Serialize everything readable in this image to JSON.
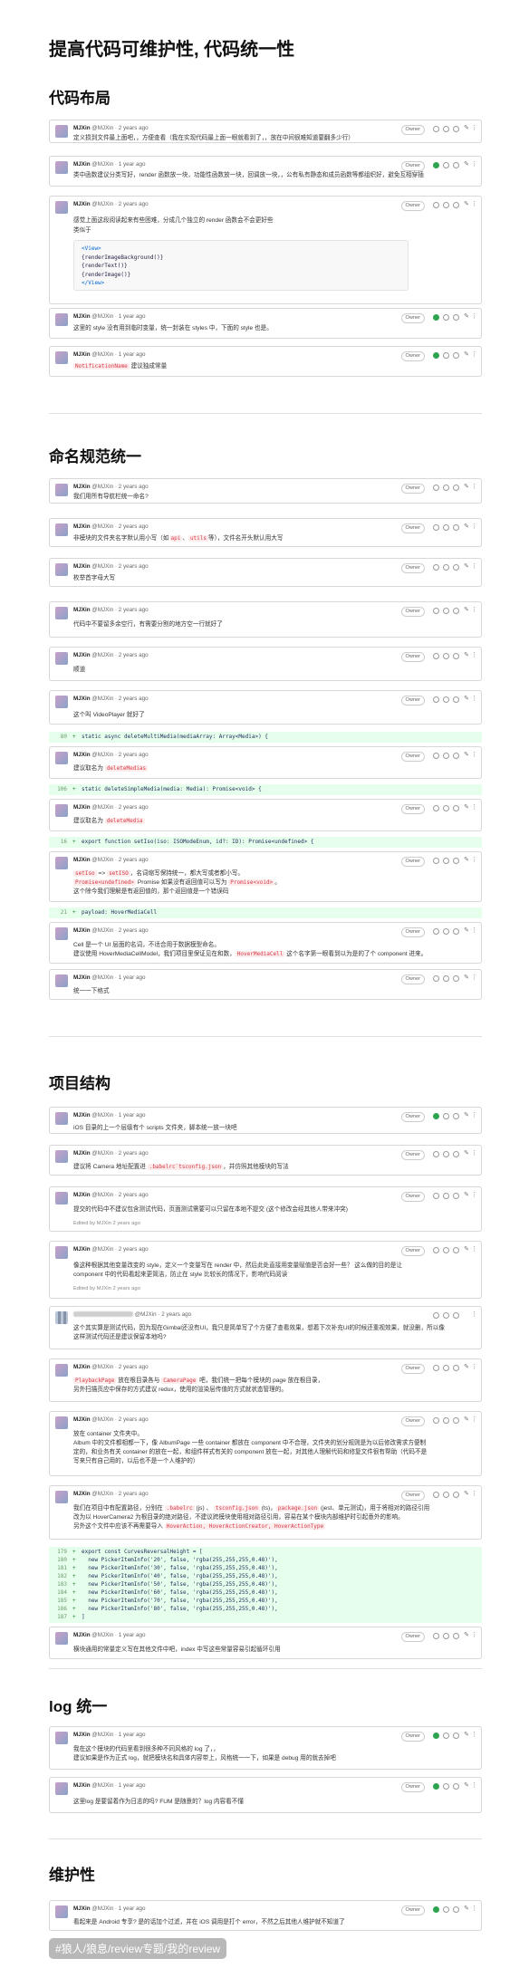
{
  "title": "提高代码可维护性, 代码统一性",
  "sections": {
    "s1": "代码布局",
    "s2": "命名规范统一",
    "s3": "项目结构",
    "s4": "log 统一",
    "s5": "维护性"
  },
  "common": {
    "owner": "Owner",
    "edit_icon": "pencil-icon",
    "more_icon": "more-icon"
  },
  "c": {
    "c1": {
      "name": "MJXin",
      "meta": "@MJXin · 2 years ago",
      "body": "定义损到文件最上面吧，，方便查看（我在实现代码最上面一眼就看到了，，放在中间很难知道要翻多少行）"
    },
    "c2": {
      "name": "MJXin",
      "meta": "@MJXin · 1 year ago",
      "body": "类中函数建议分类写好，render 函数放一块，功能性函数放一块，回调放一块，，公有私有静态和成员函数等都组织好，避免互相穿插"
    },
    "c3": {
      "name": "MJXin",
      "meta": "@MJXin · 2 years ago",
      "body1": "感觉上面这段阅读起来有些困难，分成几个独立的 render 函数会不会更好些",
      "body2": "类似于",
      "code": [
        "<View>",
        "  {renderImageBackground()}",
        "  {renderText()}",
        "  {renderImage()}",
        "</View>"
      ]
    },
    "c4": {
      "name": "MJXin",
      "meta": "@MJXin · 1 year ago",
      "body": "这里的 style 没有用到临时变量，统一封装在 styles 中，下面的 style 也是。"
    },
    "c5": {
      "name": "MJXin",
      "meta": "@MJXin · 1 year ago",
      "code": "NotificationName",
      "body": "建议独成常量"
    },
    "n1": {
      "name": "MJXin",
      "meta": "@MJXin · 2 years ago",
      "body": "我们用所有导航栏统一命名?"
    },
    "n2": {
      "name": "MJXin",
      "meta": "@MJXin · 2 years ago",
      "b1": "非模块的文件夹名字默认用小写（如",
      "k1": "api",
      "b2": "、",
      "k2": "utils",
      "b3": "等），文件名开头默认用大写"
    },
    "n3": {
      "name": "MJXin",
      "meta": "@MJXin · 2 years ago",
      "body": "枚举首字母大写"
    },
    "n4": {
      "name": "MJXin",
      "meta": "@MJXin · 2 years ago",
      "body": "代码中不要留多余空行，有需要分割的地方空一行就好了"
    },
    "n5": {
      "name": "MJXin",
      "meta": "@MJXin · 2 years ago",
      "body": "顺道"
    },
    "n6": {
      "name": "MJXin",
      "meta": "@MJXin · 2 years ago",
      "body": "这个叫 VideoPlayer 就好了"
    },
    "d1": {
      "ln": "80",
      "code": "static async deleteMultiMedia(mediaArray: Array<Media>) {"
    },
    "n7": {
      "name": "MJXin",
      "meta": "@MJXin · 2 years ago",
      "b1": "建议取名为",
      "k1": "deleteMedias"
    },
    "d2": {
      "ln": "106",
      "code": "static deleteSimpleMedia(media: Media): Promise<void> {"
    },
    "n8": {
      "name": "MJXin",
      "meta": "@MJXin · 2 years ago",
      "b1": "建议取名为",
      "k1": "deleteMedia"
    },
    "d3": {
      "ln": "16",
      "code": "export function setIso(iso: ISOModeEnum, id?: ID): Promise<undefined> {"
    },
    "n9": {
      "name": "MJXin",
      "meta": "@MJXin · 2 years ago",
      "k1": "setIso",
      "b1": " => ",
      "k2": "setISO",
      "b2": "，名词缩写保持统一，都大写或者都小写。",
      "k3": "Promise<undefined>",
      "b3": " Promise 如果没有返回值可以写为 ",
      "k4": "Promise<void>",
      "b4": "。",
      "b5": "这个除今我们理解是有返回值的，那个返回值是一个错误码"
    },
    "d4": {
      "ln": "21",
      "code": "payload: HoverMediaCell"
    },
    "n10": {
      "name": "MJXin",
      "meta": "@MJXin · 2 years ago",
      "b1": "Cell 是一个 UI 层面的名词，不适合用于数据模型命名。",
      "b2": "建议使用 HoverMediaCellModel，我们项目里保证见在和数，",
      "k1": "HoverMediaCell",
      "b3": " 这个名字第一眼看到以为是的了个 component 进来。"
    },
    "n11": {
      "name": "MJXin",
      "meta": "@MJXin · 1 year ago",
      "body": "统一一下格式"
    },
    "p1": {
      "name": "MJXin",
      "meta": "@MJXin · 1 year ago",
      "body": "iOS 目录的上一个层级有个 scripts 文件夹，脚本统一放一块吧"
    },
    "p2": {
      "name": "MJXin",
      "meta": "@MJXin · 2 years ago",
      "b1": "建议将 Camera 地址配置进 ",
      "k1": ".babelrc`tsconfig.json",
      "b2": "，并仿照其他模块的写法"
    },
    "p3": {
      "name": "MJXin",
      "meta": "@MJXin · 2 years ago",
      "body": "提交的代码中不建议包含测试代码，页面测试需要可以只留在本地不提交 (这个修改会经其他人带来冲突)",
      "edited": "Edited by MJXin 2 years ago"
    },
    "p4": {
      "name": "MJXin",
      "meta": "@MJXin · 2 years ago",
      "b1": "像这种根据其他变量改变的 style，定义一个变量写在 render 中，然后此处直接用变量赋值是否会好一些？ 这么做的目的是让",
      "b2": "component 中的代码看起来更简洁，防止在 style 比较长的情况下，影响代码阅读",
      "edited": "Edited by MJXin 2 years ago"
    },
    "p5": {
      "meta": "@MJXin · 2 years ago",
      "b1": "这个其实算是测试代码，因为现在Gimbal还没有UI，我只是简单写了个方便了查看效果，想着下次补充UI的时候还重视效果，就没删，所以像",
      "b2": "这样测试代码还是建议保留本地吗?"
    },
    "p6": {
      "name": "MJXin",
      "meta": "@MJXin · 2 years ago",
      "k1": "PlaybackPage",
      "b1": " 放在根目录各与 ",
      "k2": "CameraPage",
      "b2": " 吧，我们统一把每个模块的 page 放在根目录，",
      "b3": "另外扫描页应中保存的方式建议 redux，使用的渲染层传值的方式就状态管理的。"
    },
    "p7": {
      "name": "MJXin",
      "meta": "@MJXin · 2 years ago",
      "b1": "放在 container 文件夹中。",
      "b2": "Album 中的文件都相都一下，像 AlbumPage 一些 container 都放在 component 中不合理，文件夹的划分规则是为以后修改需求方便制",
      "b3": "定的，和业务有关 container 的放在一起，和组件样式有关的 component 放在一起，对其他人理解代码和修复文件很有帮助（代码不是",
      "b4": "写来只有自己用的，以后也不是一个人维护的）"
    },
    "p8": {
      "name": "MJXin",
      "meta": "@MJXin · 2 years ago",
      "b1": "我们在项目中有配置路径，分别在 ",
      "k1": ".babelrc",
      "b2": " (js) 、 ",
      "k2": "tsconfig.json",
      "b3": " (ts)，",
      "k3": "package.json",
      "b4": " (jest、单元测试)，用于将相对的路径引用",
      "b5": "改为以 HoverCamera2 为根目录的绝对路径，不建议跨模块使用相对路径引用，容易在某个模块内部维护时引起意外的影响。",
      "b6": "另外这个文件中应该不再需要导入 ",
      "k4": "HoverAction, HoverActionCreator, HoverActionType"
    },
    "d5": {
      "rows": [
        {
          "ln": "179",
          "code": "export const CurvesReversalHeight = ["
        },
        {
          "ln": "180",
          "code": "  new PickerItemInfo('20', false, 'rgba(255,255,255,0.48)'),"
        },
        {
          "ln": "181",
          "code": "  new PickerItemInfo('30', false, 'rgba(255,255,255,0.48)'),"
        },
        {
          "ln": "182",
          "code": "  new PickerItemInfo('40', false, 'rgba(255,255,255,0.48)'),"
        },
        {
          "ln": "183",
          "code": "  new PickerItemInfo('50', false, 'rgba(255,255,255,0.48)'),"
        },
        {
          "ln": "184",
          "code": "  new PickerItemInfo('60', false, 'rgba(255,255,255,0.48)'),"
        },
        {
          "ln": "185",
          "code": "  new PickerItemInfo('70', false, 'rgba(255,255,255,0.48)'),"
        },
        {
          "ln": "186",
          "code": "  new PickerItemInfo('80', false, 'rgba(255,255,255,0.48)'),"
        },
        {
          "ln": "187",
          "code": "]"
        }
      ]
    },
    "p9": {
      "name": "MJXin",
      "meta": "@MJXin · 1 year ago",
      "body": "横块通用的常量定义写在其他文件中吧，index 中写这些常量容易引起循环引用"
    },
    "l1": {
      "name": "MJXin",
      "meta": "@MJXin · 1 year ago",
      "b1": "我在这个模块的代码里看到很多种不同风格的 log 了，，",
      "b2": "建议如果是作为正式 log，就把模块名和具体内容带上，风格统一一下，如果是 debug 用的就去掉吧"
    },
    "l2": {
      "name": "MJXin",
      "meta": "@MJXin · 1 year ago",
      "body": "这里log 是要留着作为日志的吗? FUM 是随意的？log 内容看不懂"
    },
    "m1": {
      "name": "MJXin",
      "meta": "@MJXin · 1 year ago",
      "body": "看起来是 Android 专享? 是的话加个过滤，并在 iOS 调用是打个 error，不然之后其他人维护就不知道了"
    }
  },
  "footer_tag": "#狼人/狼息/review专题/我的review"
}
